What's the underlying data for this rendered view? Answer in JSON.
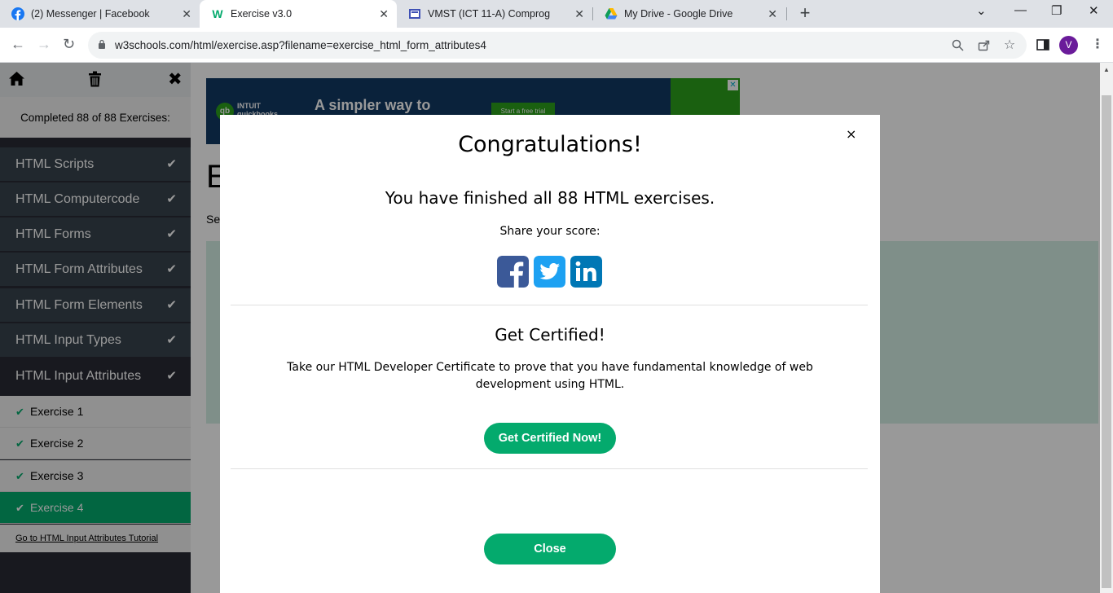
{
  "browser": {
    "tabs": [
      {
        "title": "(2) Messenger | Facebook",
        "icon": "facebook-icon"
      },
      {
        "title": "Exercise v3.0",
        "icon": "w3schools-icon"
      },
      {
        "title": "VMST (ICT 11-A) Comprog",
        "icon": "classroom-icon"
      },
      {
        "title": "My Drive - Google Drive",
        "icon": "google-drive-icon"
      }
    ],
    "active_tab": 1,
    "url": "w3schools.com/html/exercise.asp?filename=exercise_html_form_attributes4",
    "profile_initial": "V"
  },
  "sidebar": {
    "completed_text": "Completed 88 of 88 Exercises:",
    "sections": [
      {
        "label": "HTML Scripts"
      },
      {
        "label": "HTML Computercode"
      },
      {
        "label": "HTML Forms"
      },
      {
        "label": "HTML Form Attributes"
      },
      {
        "label": "HTML Form Elements"
      },
      {
        "label": "HTML Input Types"
      },
      {
        "label": "HTML Input Attributes"
      }
    ],
    "exercises": [
      {
        "label": "Exercise 1"
      },
      {
        "label": "Exercise 2"
      },
      {
        "label": "Exercise 3"
      },
      {
        "label": "Exercise 4"
      }
    ],
    "active_exercise": 3,
    "tutorial_link": "Go to HTML Input Attributes Tutorial"
  },
  "ad": {
    "brand_top": "INTUIT",
    "brand_bottom": "quickbooks",
    "headline": "A simpler way to",
    "cta": "Start a free trial"
  },
  "background_page": {
    "heading_fragment": "E",
    "subtext_fragment": "Se"
  },
  "modal": {
    "title": "Congratulations!",
    "finished_text": "You have finished all 88 HTML exercises.",
    "share_label": "Share your score:",
    "certified_title": "Get Certified!",
    "certified_desc": "Take our HTML Developer Certificate to prove that you have fundamental knowledge of web development using HTML.",
    "certified_button": "Get Certified Now!",
    "close_button": "Close"
  },
  "colors": {
    "w3_green": "#04aa6d",
    "sidebar_dark": "#38444d",
    "facebook": "#3b5998",
    "twitter": "#1da1f2",
    "linkedin": "#0077b5"
  }
}
